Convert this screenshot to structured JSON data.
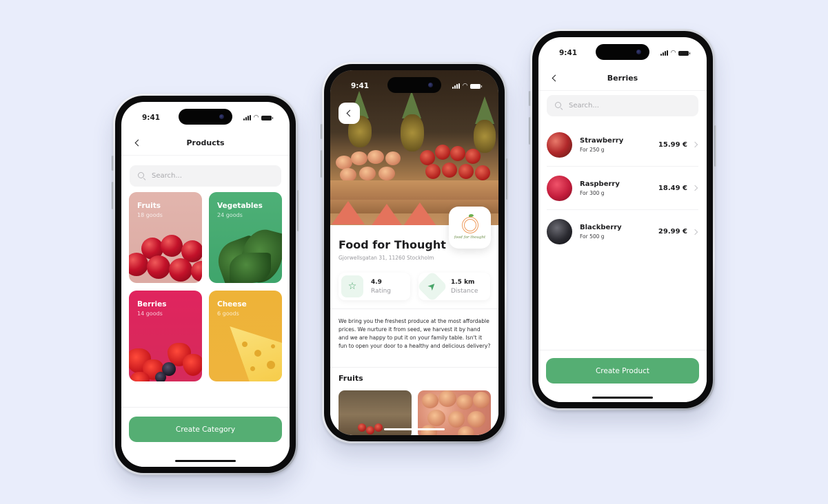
{
  "status_bar": {
    "time": "9:41"
  },
  "products_screen": {
    "title": "Products",
    "search_placeholder": "Search...",
    "categories": [
      {
        "name": "Fruits",
        "count": "18 goods",
        "color": "#dcaaa3"
      },
      {
        "name": "Vegetables",
        "count": "24 goods",
        "color": "#46ab70"
      },
      {
        "name": "Berries",
        "count": "14 goods",
        "color": "#dc275d"
      },
      {
        "name": "Cheese",
        "count": "6 goods",
        "color": "#efb43a"
      }
    ],
    "primary_button": "Create Category"
  },
  "store_screen": {
    "store_name": "Food for Thought",
    "address": "Gjorwellsgatan 31, 11260 Stockholm",
    "logo_text": "food for thought",
    "stats": [
      {
        "icon": "star-icon",
        "value": "4.9",
        "label": "Rating"
      },
      {
        "icon": "navigation-arrow-icon",
        "value": "1.5 km",
        "label": "Distance"
      }
    ],
    "description": "We bring you the freshest produce at the most affordable prices. We nurture it from seed, we harvest it by hand and we are happy to put it on your family table. Isn't it fun to open your door to a healthy and delicious delivery?",
    "section_title": "Fruits"
  },
  "berries_screen": {
    "title": "Berries",
    "search_placeholder": "Search...",
    "products": [
      {
        "name": "Strawberry",
        "quantity": "For 250 g",
        "price": "15.99 €"
      },
      {
        "name": "Raspberry",
        "quantity": "For 300 g",
        "price": "18.49 €"
      },
      {
        "name": "Blackberry",
        "quantity": "For 500 g",
        "price": "29.99 €"
      }
    ],
    "primary_button": "Create Product"
  },
  "colors": {
    "background": "#e9edfb",
    "accent_green": "#55ae73",
    "search_bg": "#f3f3f4"
  }
}
